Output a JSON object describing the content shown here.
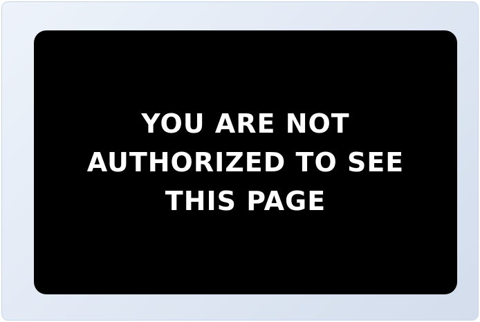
{
  "colors": {
    "frame_background": "#dfe7f3",
    "frame_border": "#c9d6e8",
    "panel_background": "#000000",
    "message_text": "#ffffff"
  },
  "message": {
    "lines": [
      "YOU ARE NOT",
      "AUTHORIZED TO SEE",
      "THIS PAGE"
    ]
  }
}
